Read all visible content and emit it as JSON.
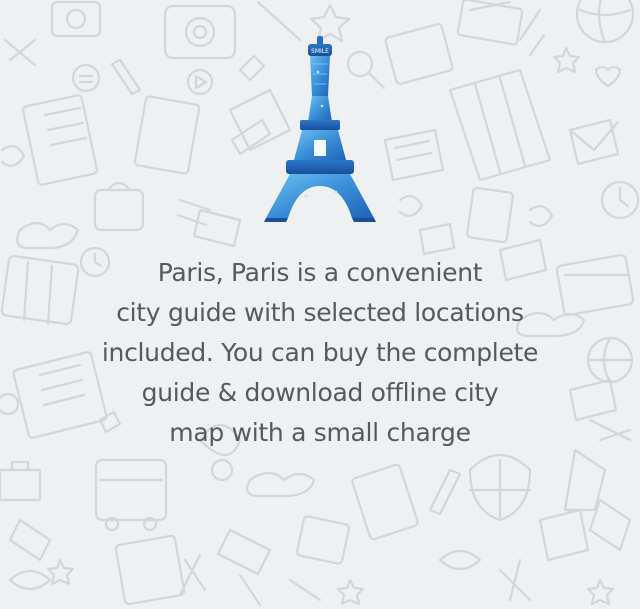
{
  "background": {
    "color": "#eef0f2",
    "pattern": "travel-doodles",
    "doodle_color": "#d3d6da"
  },
  "logo": {
    "icon": "eiffel-tower-icon",
    "color": "#3a8fd8",
    "label": "SMILE"
  },
  "intro": {
    "text": "Paris, Paris is a convenient\ncity guide with selected locations\nincluded. You can buy the complete\nguide & download offline city\nmap with a small charge"
  }
}
